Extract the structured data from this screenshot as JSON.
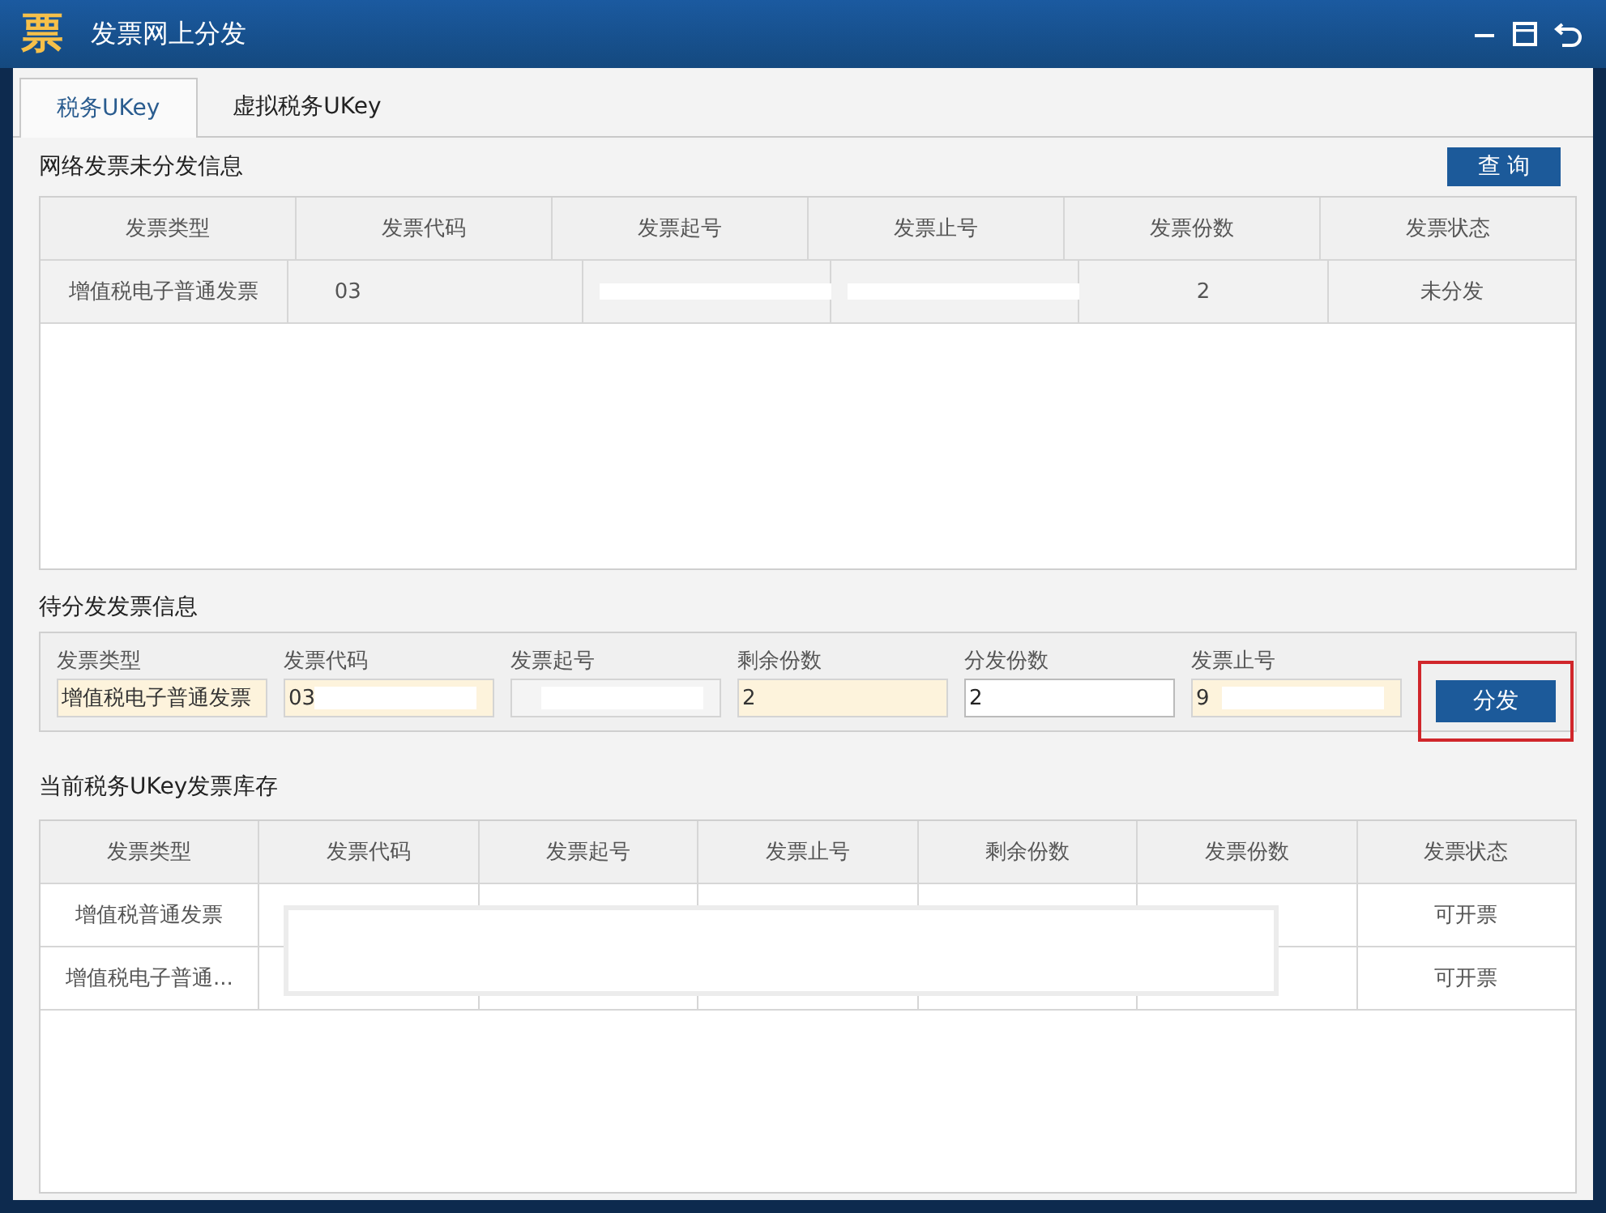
{
  "window": {
    "title": "发票网上分发",
    "logo": "票"
  },
  "tabs": [
    {
      "label": "税务UKey",
      "selected": true
    },
    {
      "label": "虚拟税务UKey",
      "selected": false
    }
  ],
  "undistributed": {
    "title": "网络发票未分发信息",
    "query_button": "查 询",
    "columns": [
      "发票类型",
      "发票代码",
      "发票起号",
      "发票止号",
      "发票份数",
      "发票状态"
    ],
    "rows": [
      [
        "增值税电子普通发票",
        "03",
        "",
        "",
        "2",
        "未分发"
      ]
    ]
  },
  "pending": {
    "title": "待分发发票信息",
    "fields": [
      {
        "label": "发票类型",
        "value": "增值税电子普通发票",
        "kind": "locked"
      },
      {
        "label": "发票代码",
        "value": "03",
        "kind": "locked"
      },
      {
        "label": "发票起号",
        "kind": "plain"
      },
      {
        "label": "剩余份数",
        "value": "2",
        "kind": "locked"
      },
      {
        "label": "分发份数",
        "value": "2",
        "kind": "input"
      },
      {
        "label": "发票止号",
        "value": "9",
        "kind": "locked"
      }
    ],
    "distribute_button": "分发"
  },
  "inventory": {
    "title": "当前税务UKey发票库存",
    "columns": [
      "发票类型",
      "发票代码",
      "发票起号",
      "发票止号",
      "剩余份数",
      "发票份数",
      "发票状态"
    ],
    "rows": [
      [
        "增值税普通发票",
        "",
        "",
        "",
        "",
        "",
        "可开票"
      ],
      [
        "增值税电子普通...",
        "",
        "",
        "",
        "",
        "",
        "可开票"
      ]
    ]
  }
}
